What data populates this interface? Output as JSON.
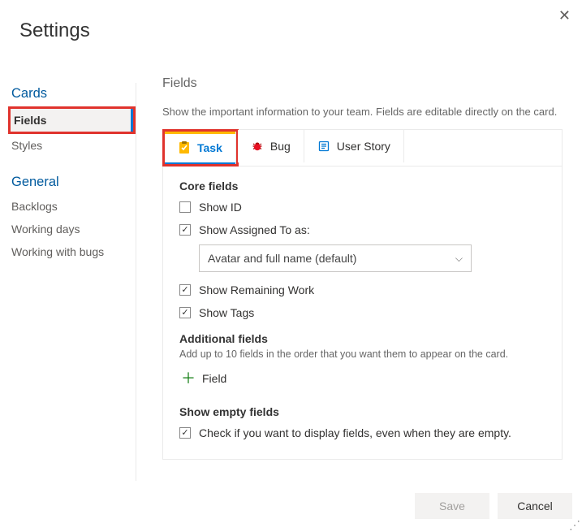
{
  "dialog": {
    "title": "Settings",
    "close_label": "Close"
  },
  "sidebar": {
    "sections": [
      {
        "title": "Cards",
        "items": [
          {
            "label": "Fields",
            "active": true,
            "highlight": true
          },
          {
            "label": "Styles"
          }
        ]
      },
      {
        "title": "General",
        "items": [
          {
            "label": "Backlogs"
          },
          {
            "label": "Working days"
          },
          {
            "label": "Working with bugs"
          }
        ]
      }
    ]
  },
  "main": {
    "heading": "Fields",
    "description": "Show the important information to your team. Fields are editable directly on the card.",
    "tabs": [
      {
        "label": "Task",
        "icon": "task-icon",
        "active": true,
        "highlight": true
      },
      {
        "label": "Bug",
        "icon": "bug-icon"
      },
      {
        "label": "User Story",
        "icon": "user-story-icon"
      }
    ],
    "core": {
      "heading": "Core fields",
      "show_id": {
        "label": "Show ID",
        "checked": false
      },
      "show_assigned": {
        "label": "Show Assigned To as:",
        "checked": true,
        "select_value": "Avatar and full name (default)"
      },
      "show_remaining": {
        "label": "Show Remaining Work",
        "checked": true
      },
      "show_tags": {
        "label": "Show Tags",
        "checked": true
      }
    },
    "additional": {
      "heading": "Additional fields",
      "description": "Add up to 10 fields in the order that you want them to appear on the card.",
      "add_label": "Field"
    },
    "empty": {
      "heading": "Show empty fields",
      "checkbox_label": "Check if you want to display fields, even when they are empty.",
      "checked": true
    }
  },
  "footer": {
    "save": "Save",
    "cancel": "Cancel"
  }
}
